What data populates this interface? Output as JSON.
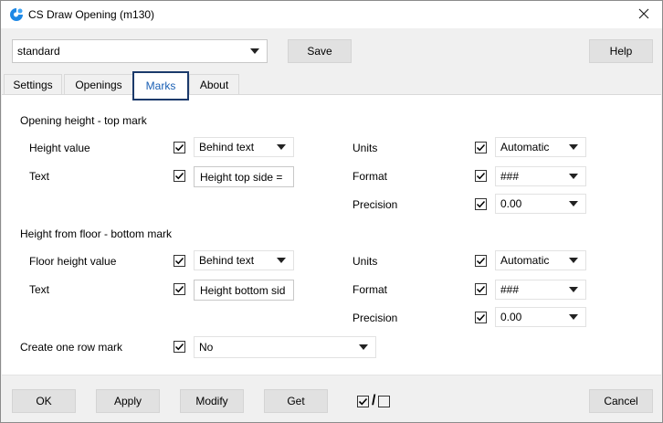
{
  "window": {
    "title": "CS Draw Opening (m130)",
    "close_glyph": "✕"
  },
  "preset": {
    "value": "standard",
    "save_label": "Save",
    "help_label": "Help"
  },
  "tabs": [
    {
      "label": "Settings"
    },
    {
      "label": "Openings"
    },
    {
      "label": "Marks"
    },
    {
      "label": "About"
    }
  ],
  "marks": {
    "top": {
      "heading": "Opening height - top mark",
      "height_value_label": "Height value",
      "height_value_checked": true,
      "height_value_option": "Behind text",
      "text_label": "Text",
      "text_checked": true,
      "text_value": "Height top side =",
      "units_label": "Units",
      "units_checked": true,
      "units_value": "Automatic",
      "format_label": "Format",
      "format_checked": true,
      "format_value": "###",
      "precision_label": "Precision",
      "precision_checked": true,
      "precision_value": "0.00"
    },
    "bottom": {
      "heading": "Height from floor - bottom mark",
      "height_value_label": "Floor height value",
      "height_value_checked": true,
      "height_value_option": "Behind text",
      "text_label": "Text",
      "text_checked": true,
      "text_value": "Height bottom sid",
      "units_label": "Units",
      "units_checked": true,
      "units_value": "Automatic",
      "format_label": "Format",
      "format_checked": true,
      "format_value": "###",
      "precision_label": "Precision",
      "precision_checked": true,
      "precision_value": "0.00"
    },
    "one_row": {
      "label": "Create one row mark",
      "checked": true,
      "value": "No"
    }
  },
  "footer": {
    "ok_label": "OK",
    "apply_label": "Apply",
    "modify_label": "Modify",
    "get_label": "Get",
    "check_toggle_separator": "/",
    "cancel_label": "Cancel"
  },
  "icons": {
    "app": "cs-app-icon",
    "close": "close-icon",
    "dropdown": "chevron-down-icon",
    "check": "checkmark-icon"
  },
  "colors": {
    "accent": "#1a5fb4",
    "active_tab_border": "#1b3a6b",
    "app_icon": "#1e88e5"
  }
}
